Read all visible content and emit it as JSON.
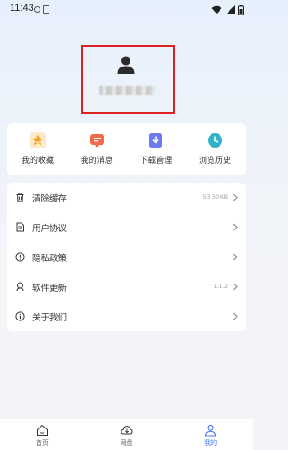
{
  "status_bar": {
    "time": "11:43"
  },
  "profile": {
    "username": ""
  },
  "quick_menu": [
    {
      "label": "我的收藏",
      "icon": "star-icon",
      "color": "#f0a224"
    },
    {
      "label": "我的消息",
      "icon": "message-icon",
      "color": "#f06a4a"
    },
    {
      "label": "下载管理",
      "icon": "download-icon",
      "color": "#6a7cf0"
    },
    {
      "label": "浏览历史",
      "icon": "clock-icon",
      "color": "#2fb3c9"
    }
  ],
  "settings": [
    {
      "label": "清除缓存",
      "value": "53.30 KB",
      "icon": "trash-icon"
    },
    {
      "label": "用户协议",
      "value": "",
      "icon": "document-icon"
    },
    {
      "label": "隐私政策",
      "value": "",
      "icon": "shield-icon"
    },
    {
      "label": "软件更新",
      "value": "1.1.2",
      "icon": "update-icon"
    },
    {
      "label": "关于我们",
      "value": "",
      "icon": "info-icon"
    }
  ],
  "bottom_nav": [
    {
      "label": "首页",
      "icon": "home-icon",
      "active": false
    },
    {
      "label": "网盘",
      "icon": "cloud-icon",
      "active": false
    },
    {
      "label": "我的",
      "icon": "user-icon",
      "active": true
    }
  ],
  "colors": {
    "accent": "#4a7cf0",
    "highlight_frame": "#d22222"
  }
}
